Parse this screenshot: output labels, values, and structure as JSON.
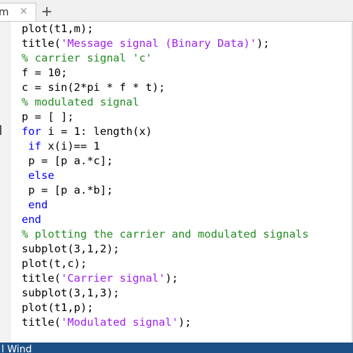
{
  "tab": {
    "title": "m",
    "close_symbol": "×",
    "new_tab_symbol": "+"
  },
  "code_lines": [
    [
      {
        "t": "plot(t1,m);",
        "c": "plain"
      }
    ],
    [
      {
        "t": "title(",
        "c": "plain"
      },
      {
        "t": "'Message signal (Binary Data)'",
        "c": "str"
      },
      {
        "t": ");",
        "c": "plain"
      }
    ],
    [
      {
        "t": "% carrier signal 'c'",
        "c": "cmt"
      }
    ],
    [
      {
        "t": "f = 10;",
        "c": "plain"
      }
    ],
    [
      {
        "t": "c = sin(2*pi * f * t);",
        "c": "plain"
      }
    ],
    [
      {
        "t": "% modulated signal",
        "c": "cmt"
      }
    ],
    [
      {
        "t": "p = [ ];",
        "c": "plain"
      }
    ],
    [
      {
        "t": "for",
        "c": "kw"
      },
      {
        "t": " i = 1: length(x)",
        "c": "plain"
      }
    ],
    [
      {
        "t": " ",
        "c": "plain"
      },
      {
        "t": "if",
        "c": "kw"
      },
      {
        "t": " x(i)== 1",
        "c": "plain"
      }
    ],
    [
      {
        "t": " p = [p a.*c];",
        "c": "plain"
      }
    ],
    [
      {
        "t": " ",
        "c": "plain"
      },
      {
        "t": "else",
        "c": "kw"
      }
    ],
    [
      {
        "t": " p = [p a.*b];",
        "c": "plain"
      }
    ],
    [
      {
        "t": " ",
        "c": "plain"
      },
      {
        "t": "end",
        "c": "kw"
      }
    ],
    [
      {
        "t": "end",
        "c": "kw"
      }
    ],
    [
      {
        "t": "% plotting the carrier and modulated signals",
        "c": "cmt"
      }
    ],
    [
      {
        "t": "subplot(3,1,2);",
        "c": "plain"
      }
    ],
    [
      {
        "t": "plot(t,c);",
        "c": "plain"
      }
    ],
    [
      {
        "t": "title(",
        "c": "plain"
      },
      {
        "t": "'Carrier signal'",
        "c": "str"
      },
      {
        "t": ");",
        "c": "plain"
      }
    ],
    [
      {
        "t": "subplot(3,1,3);",
        "c": "plain"
      }
    ],
    [
      {
        "t": "plot(t1,p);",
        "c": "plain"
      }
    ],
    [
      {
        "t": "title(",
        "c": "plain"
      },
      {
        "t": "'Modulated signal'",
        "c": "str"
      },
      {
        "t": ");",
        "c": "plain"
      }
    ]
  ],
  "status_strip": {
    "label": "l Wind"
  },
  "colors": {
    "keyword": "#0000ff",
    "string": "#a020f0",
    "comment": "#228b22",
    "status_strip": "#1c4f86"
  }
}
